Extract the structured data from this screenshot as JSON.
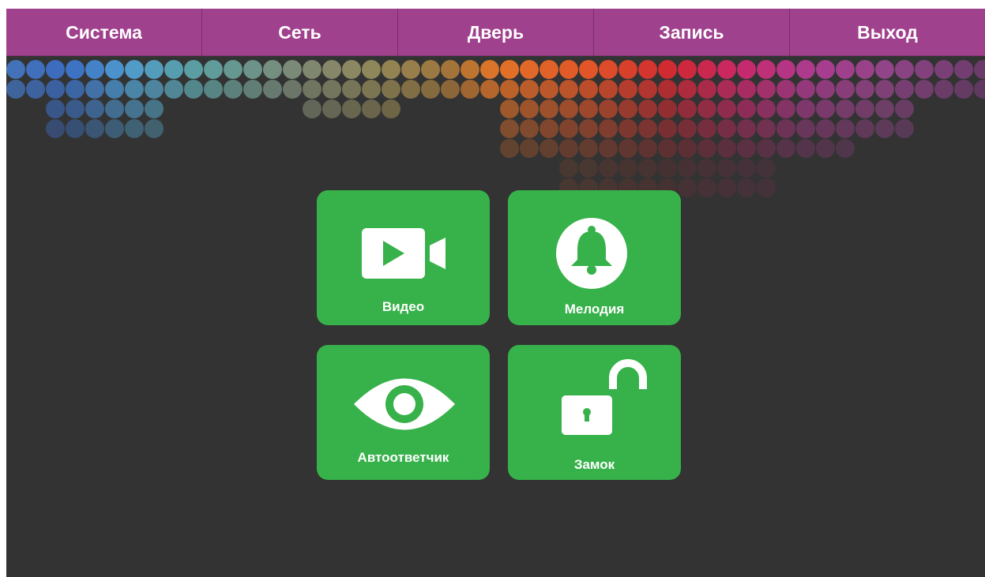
{
  "nav": {
    "tabs": [
      {
        "label": "Система"
      },
      {
        "label": "Сеть"
      },
      {
        "label": "Дверь"
      },
      {
        "label": "Запись"
      },
      {
        "label": "Выход"
      }
    ]
  },
  "tiles": [
    {
      "label": "Видео",
      "icon": "video-camera-icon"
    },
    {
      "label": "Мелодия",
      "icon": "bell-icon"
    },
    {
      "label": "Автоответчик",
      "icon": "eye-icon"
    },
    {
      "label": "Замок",
      "icon": "unlocked-padlock-icon"
    }
  ],
  "colors": {
    "nav_bar": "#a0418e",
    "background": "#333333",
    "tile": "#37b14a",
    "text": "#ffffff"
  }
}
